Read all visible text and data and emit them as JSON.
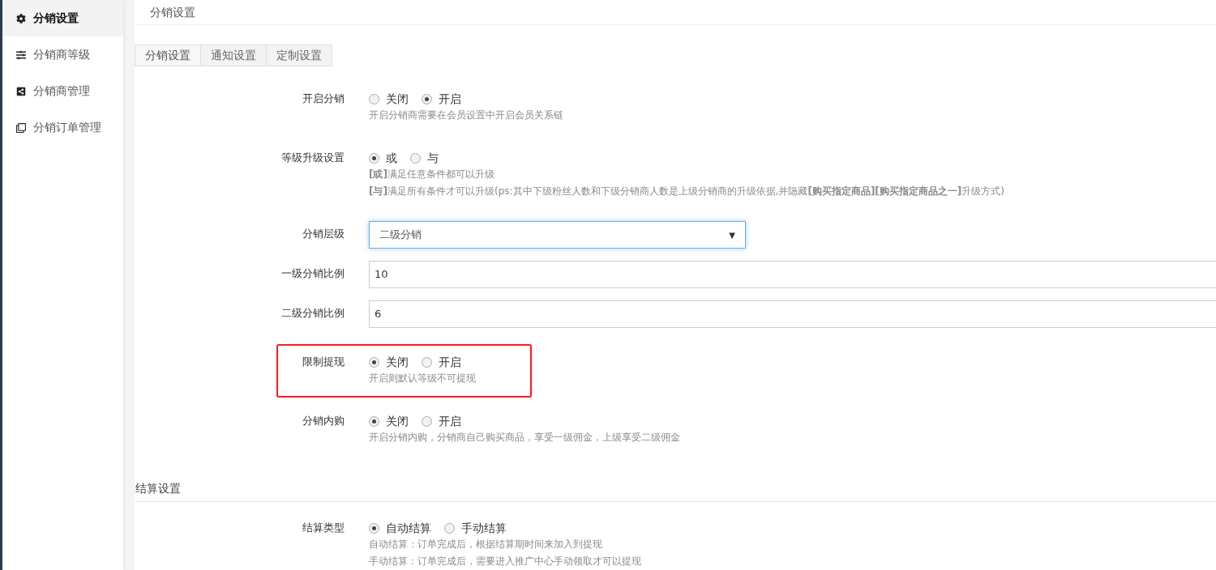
{
  "sidebar": {
    "items": [
      {
        "label": "分销设置",
        "selected": true
      },
      {
        "label": "分销商等级",
        "selected": false
      },
      {
        "label": "分销商管理",
        "selected": false
      },
      {
        "label": "分销订单管理",
        "selected": false
      }
    ]
  },
  "page_title": "分销设置",
  "tabs": [
    {
      "label": "分销设置",
      "selected": true
    },
    {
      "label": "通知设置",
      "selected": false
    },
    {
      "label": "定制设置",
      "selected": false
    }
  ],
  "form": [
    {
      "kind": "radio",
      "label": "开启分销",
      "highlighted": false,
      "options": [
        {
          "label": "关闭",
          "selected": false
        },
        {
          "label": "开启",
          "selected": true
        }
      ],
      "notes": [
        "开启分销商需要在会员设置中开启会员关系链"
      ]
    },
    {
      "kind": "radio",
      "label": "等级升级设置",
      "highlighted": false,
      "options": [
        {
          "label": "或",
          "selected": true
        },
        {
          "label": "与",
          "selected": false
        }
      ],
      "notes": [
        "**[或]**满足任意条件都可以升级",
        "**[与]**满足所有条件才可以升级(ps:其中下级粉丝人数和下级分销商人数是上级分销商的升级依据,并隐藏**[购买指定商品][购买指定商品之一]**升级方式)"
      ]
    },
    {
      "kind": "select",
      "label": "分销层级",
      "value": "二级分销",
      "caret": "▼"
    },
    {
      "kind": "input",
      "label": "一级分销比例",
      "value": "10"
    },
    {
      "kind": "input",
      "label": "二级分销比例",
      "value": "6"
    },
    {
      "kind": "radio",
      "label": "限制提现",
      "highlighted": true,
      "options": [
        {
          "label": "关闭",
          "selected": true
        },
        {
          "label": "开启",
          "selected": false
        }
      ],
      "notes": [
        "开启则默认等级不可提现"
      ]
    },
    {
      "kind": "radio",
      "label": "分销内购",
      "highlighted": false,
      "options": [
        {
          "label": "关闭",
          "selected": true
        },
        {
          "label": "开启",
          "selected": false
        }
      ],
      "notes": [
        "开启分销内购，分销商自己购买商品，享受一级佣金，上级享受二级佣金"
      ]
    }
  ],
  "settlement": {
    "title": "结算设置",
    "form": [
      {
        "kind": "radio",
        "label": "结算类型",
        "highlighted": false,
        "options": [
          {
            "label": "自动结算",
            "selected": true
          },
          {
            "label": "手动结算",
            "selected": false
          }
        ],
        "notes": [
          "自动结算：订单完成后，根据结算期时间来加入到提现",
          "手动结算：订单完成后，需要进入推广中心手动领取才可以提现"
        ]
      }
    ]
  }
}
